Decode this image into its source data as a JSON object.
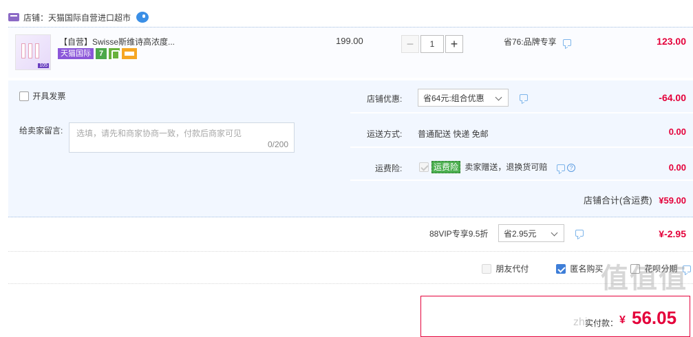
{
  "shop": {
    "label": "店铺：",
    "name": "天猫国际自营进口超市"
  },
  "item": {
    "title": "【自营】Swisse斯维诗高浓度...",
    "badge_tmall": "天猫国际",
    "badge_seven": "7",
    "thumb_price": "105",
    "unit_price": "199.00",
    "quantity": "1",
    "minus": "−",
    "plus": "+",
    "promo": "省76:品牌专享",
    "total": "123.00"
  },
  "invoice": {
    "label": "开具发票"
  },
  "message": {
    "label": "给卖家留言:",
    "placeholder": "选填，请先和商家协商一致，付款后商家可见",
    "counter": "0/200"
  },
  "shop_discount": {
    "label": "店铺优惠:",
    "selected": "省64元:组合优惠",
    "amount": "-64.00"
  },
  "shipping": {
    "label": "运送方式:",
    "value": "普通配送 快递 免邮",
    "amount": "0.00"
  },
  "insurance": {
    "label": "运费险:",
    "tag": "运费险",
    "value": "卖家赠送，退换货可赔",
    "help": "?",
    "amount": "0.00"
  },
  "subtotal": {
    "label": "店铺合计(含运费)",
    "amount": "¥59.00"
  },
  "vip": {
    "label": "88VIP专享9.5折",
    "selected": "省2.95元",
    "amount": "¥-2.95"
  },
  "pay_options": {
    "friend_pay": "朋友代付",
    "anonymous": "匿名购买",
    "huabei": "花呗分期"
  },
  "payment": {
    "label": "实付款：",
    "currency": "¥",
    "amount": "56.05"
  },
  "watermark": {
    "text": "值值值",
    "url": "zhiz"
  },
  "colors": {
    "accent_red": "#e4003a",
    "panel_blue": "#f2f7ff",
    "tmall_purple": "#8b56d9"
  }
}
